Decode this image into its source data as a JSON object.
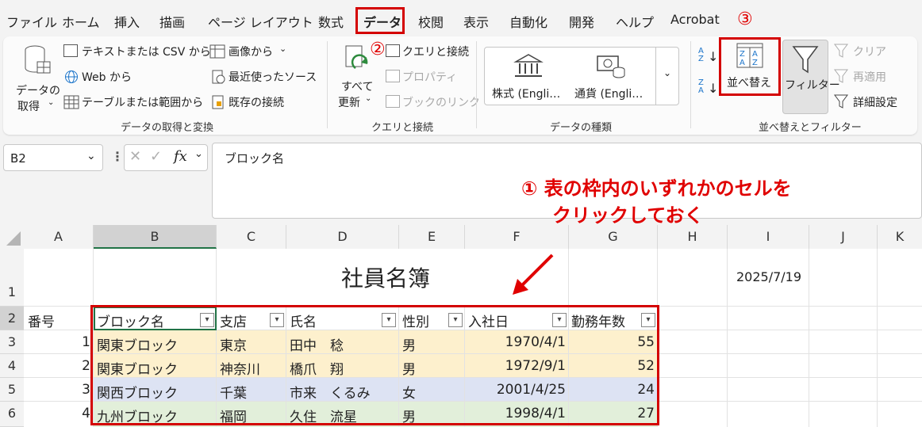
{
  "menu": [
    "ファイル",
    "ホーム",
    "挿入",
    "描画",
    "ページ レイアウト",
    "数式",
    "データ",
    "校閲",
    "表示",
    "自動化",
    "開発",
    "ヘルプ",
    "Acrobat"
  ],
  "ribbon": {
    "get_data": {
      "btn_line1": "データの",
      "btn_line2": "取得",
      "text_csv": "テキストまたは CSV から",
      "web": "Web から",
      "table_range": "テーブルまたは範囲から",
      "from_image": "画像から",
      "recent_sources": "最近使ったソース",
      "existing_conn": "既存の接続",
      "label": "データの取得と変換"
    },
    "queries": {
      "refresh_line1": "すべて",
      "refresh_line2": "更新",
      "queries_conn": "クエリと接続",
      "properties": "プロパティ",
      "book_links": "ブックのリンク",
      "label": "クエリと接続"
    },
    "data_types": {
      "stocks": "株式 (Engli…",
      "currency": "通貨 (Engli…",
      "label": "データの種類"
    },
    "sort_filter": {
      "sort": "並べ替え",
      "filter": "フィルター",
      "clear": "クリア",
      "reapply": "再適用",
      "advanced": "詳細設定",
      "label": "並べ替えとフィルター"
    }
  },
  "annotations": {
    "step1_line1": "① 表の枠内のいずれかのセルを",
    "step1_line2": "クリックしておく",
    "step2": "②",
    "step3": "③"
  },
  "formula_bar": {
    "name_box": "B2",
    "formula": "ブロック名"
  },
  "columns": [
    "A",
    "B",
    "C",
    "D",
    "E",
    "F",
    "G",
    "H",
    "I",
    "J",
    "K"
  ],
  "rows": [
    "1",
    "2",
    "3",
    "4",
    "5",
    "6"
  ],
  "sheet": {
    "title": "社員名簿",
    "date": "2025/7/19",
    "header_a": "番号",
    "headers": [
      "ブロック名",
      "支店",
      "氏名",
      "性別",
      "入社日",
      "勤務年数"
    ],
    "data": [
      {
        "no": "1",
        "block": "関東ブロック",
        "branch": "東京",
        "name": "田中　稔",
        "sex": "男",
        "date": "1970/4/1",
        "years": "55"
      },
      {
        "no": "2",
        "block": "関東ブロック",
        "branch": "神奈川",
        "name": "橋爪　翔",
        "sex": "男",
        "date": "1972/9/1",
        "years": "52"
      },
      {
        "no": "3",
        "block": "関西ブロック",
        "branch": "千葉",
        "name": "市来　くるみ",
        "sex": "女",
        "date": "2001/4/25",
        "years": "24"
      },
      {
        "no": "4",
        "block": "九州ブロック",
        "branch": "福岡",
        "name": "久住　流星",
        "sex": "男",
        "date": "1998/4/1",
        "years": "27"
      }
    ]
  },
  "colors": {
    "kanto": "#fdf0cd",
    "kansai": "#dde3f3",
    "kyushu": "#e2efda",
    "accent_red": "#d40000"
  }
}
